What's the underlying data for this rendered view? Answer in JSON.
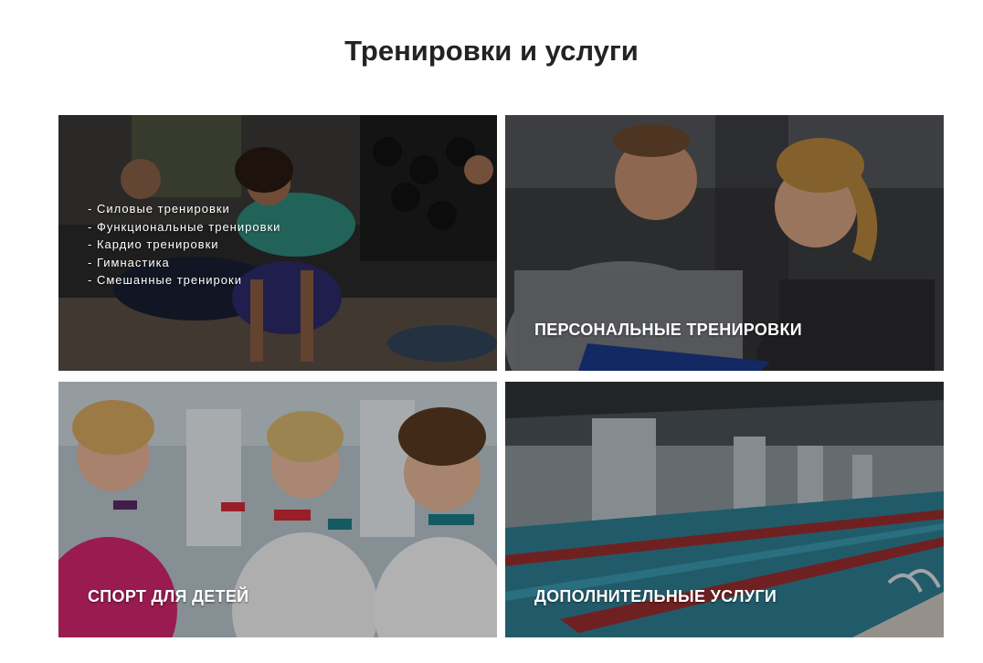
{
  "section": {
    "title": "Тренировки и услуги"
  },
  "tiles": [
    {
      "list": [
        "- Силовые тренировки",
        "- Функциональные тренировки",
        "- Кардио тренировки",
        "- Гимнастика",
        "- Смешанные тренироки"
      ]
    },
    {
      "label": "ПЕРСОНАЛЬНЫЕ ТРЕНИРОВКИ"
    },
    {
      "label": "СПОРТ ДЛЯ ДЕТЕЙ"
    },
    {
      "label": "ДОПОЛНИТЕЛЬНЫЕ УСЛУГИ"
    }
  ],
  "colors": {
    "title": "#232323",
    "overlay_text": "#ffffff"
  }
}
